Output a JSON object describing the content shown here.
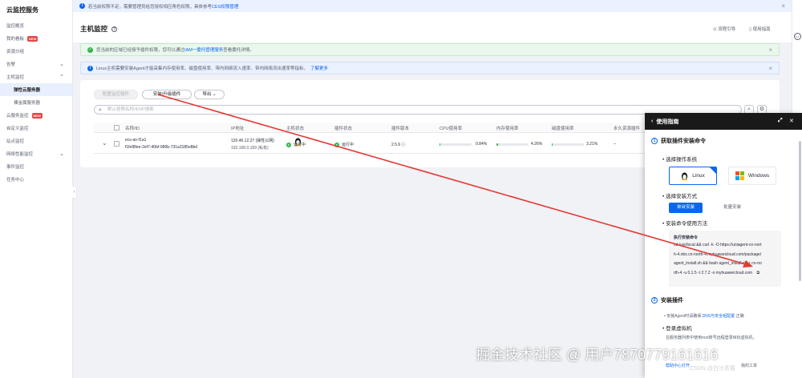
{
  "sidebar": {
    "brand": "云监控服务",
    "items": [
      {
        "label": "监控概览",
        "new": false,
        "sub": false,
        "active": false,
        "chev": ""
      },
      {
        "label": "我的看板",
        "new": true,
        "sub": false,
        "active": false,
        "chev": ""
      },
      {
        "label": "资源分组",
        "new": false,
        "sub": false,
        "active": false,
        "chev": ""
      },
      {
        "label": "告警",
        "new": false,
        "sub": false,
        "active": false,
        "chev": "⌄"
      },
      {
        "label": "主机监控",
        "new": false,
        "sub": false,
        "active": false,
        "chev": "⌃"
      },
      {
        "label": "弹性云服务器",
        "new": false,
        "sub": true,
        "active": true,
        "chev": ""
      },
      {
        "label": "裸金属服务器",
        "new": false,
        "sub": true,
        "active": false,
        "chev": ""
      },
      {
        "label": "云服务监控",
        "new": true,
        "sub": false,
        "active": false,
        "chev": ""
      },
      {
        "label": "自定义监控",
        "new": false,
        "sub": false,
        "active": false,
        "chev": ""
      },
      {
        "label": "站点监控",
        "new": false,
        "sub": false,
        "active": false,
        "chev": ""
      },
      {
        "label": "网络性能监控",
        "new": false,
        "sub": false,
        "active": false,
        "chev": "⌄"
      },
      {
        "label": "事件监控",
        "new": false,
        "sub": false,
        "active": false,
        "chev": ""
      },
      {
        "label": "任务中心",
        "new": false,
        "sub": false,
        "active": false,
        "chev": ""
      }
    ],
    "new_badge": "NEW"
  },
  "top_notice": {
    "text": "若当前权限不足，需要管理员给您授权相应角色权限，具体参考",
    "link": "CES权限管理"
  },
  "header": {
    "title": "主机监控",
    "flow_link": "流程引导",
    "guide_link": "使用指南"
  },
  "alerts": {
    "green_text": "您当前的区域已经授予插件权限，您可以通过",
    "green_link": "IAM一委托管理服务",
    "green_tail": "查看委托详情。",
    "blue_text": "Linux主机需要安装Agent才能采集内存使用率、磁盘使用率、带内网络流入速率、带内网络流出速率等指标。",
    "blue_link": "了解更多"
  },
  "toolbar": {
    "config_btn": "配置监控插件",
    "install_btn": "安装/升级插件",
    "export_btn": "导出",
    "search_placeholder": "默认按照名称/ID/IP搜索"
  },
  "table": {
    "headers": [
      "名称/ID",
      "IP地址",
      "主机状态",
      "插件状态",
      "插件版本",
      "CPU使用率",
      "内存使用率",
      "磁盘使用率",
      "永久资源插件"
    ],
    "row": {
      "name": "ecs-an-f1a1",
      "id": "f1fe88ee-2ef7-40bf-980b-731a3185e8bd",
      "ip1": "120.46.12.27 (弹性公网)",
      "ip2": "192.168.0.189 (私有)",
      "host_status": "运行中",
      "agent_status": "运行中",
      "agent_version": "2.5.6",
      "cpu": "0.84%",
      "mem": "4.26%",
      "disk": "3.21%",
      "perm": "--"
    },
    "usage": {
      "cpu": 0.84,
      "mem": 4.26,
      "disk": 3.21
    }
  },
  "guide": {
    "title": "使用指南",
    "step1_title": "获取插件安装命令",
    "step1_num": "1",
    "choose_os": "选择操作系统",
    "os_linux": "Linux",
    "os_windows": "Windows",
    "choose_method": "选择安装方式",
    "tab_single": "单台安装",
    "tab_batch": "批量安装",
    "install_cmd_label": "安装命令使用方法",
    "cmd_title": "执行安装命令",
    "cmd_lines": [
      "cd /usr/local && curl -k -O https://uniagent-cn-nort",
      "h-4.obs.cn-north-4.myhuaweicloud.com/package/",
      "agent_install.sh && bash agent_install.sh -r cn-no",
      "rth-4 -u 0.1.5 -t 2.7.2 -o myhuaweicloud.com"
    ],
    "step2_num": "2",
    "step2_title": "安装插件",
    "step2_note": "安装Agent时请确保",
    "step2_link": "DNS与安全组配置",
    "step2_tail": "正确",
    "login_host": "登录虚拟机",
    "login_desc": "在服务器列表中使用root账号远程登录目标虚拟机。",
    "login_link": "服务器列表",
    "footer": "帮助中心打开",
    "footer2": "我的工单"
  },
  "watermark": "掘金技术社区 @ 用户7870779161616",
  "watermark_small": "CSDN @白沙青春"
}
